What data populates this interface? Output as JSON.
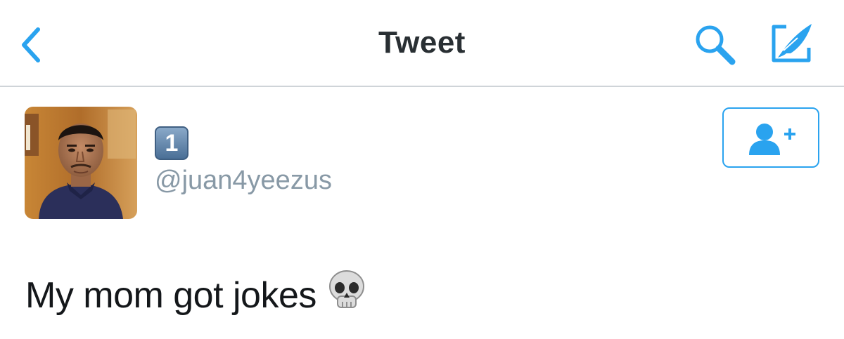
{
  "navbar": {
    "title": "Tweet",
    "accent_color": "#1da1f2",
    "back_icon": "chevron-left-icon",
    "search_icon": "search-icon",
    "compose_icon": "compose-tweet-icon"
  },
  "user": {
    "display_name": "1",
    "display_name_style": "keycap-digit-emoji",
    "handle": "@juan4yeezus",
    "follow_icon": "add-user-icon"
  },
  "tweet": {
    "text": "My mom got jokes",
    "emoji": "skull-emoji"
  }
}
